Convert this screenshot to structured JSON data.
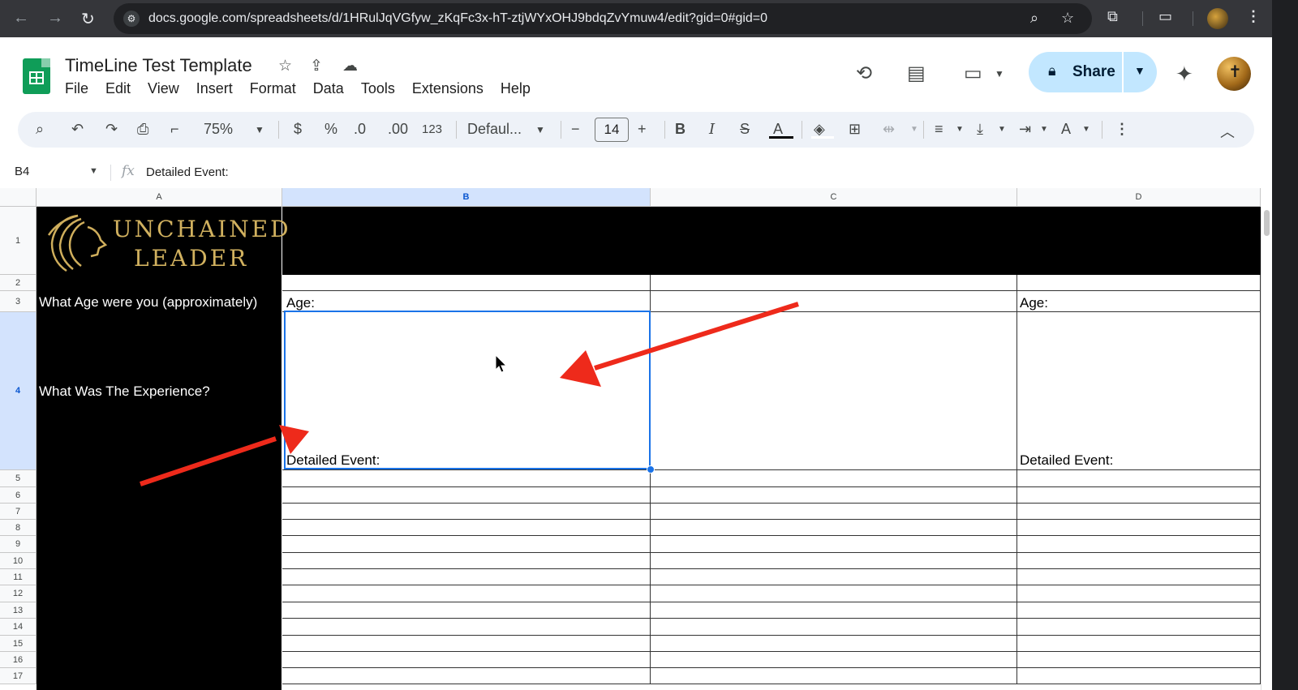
{
  "browser": {
    "url": "docs.google.com/spreadsheets/d/1HRulJqVGfyw_zKqFc3x-hT-ztjWYxOHJ9bdqZvYmuw4/edit?gid=0#gid=0",
    "icons": [
      "back-icon",
      "forward-icon",
      "reload-icon",
      "site-settings-icon",
      "zoom-icon",
      "bookmark-star-icon",
      "extensions-icon",
      "reading-mode-icon",
      "profile-avatar",
      "more-menu-icon"
    ]
  },
  "doc": {
    "title": "TimeLine Test Template",
    "menu": [
      "File",
      "Edit",
      "View",
      "Insert",
      "Format",
      "Data",
      "Tools",
      "Extensions",
      "Help"
    ],
    "share_label": "Share"
  },
  "toolbar": {
    "zoom": "75%",
    "currency": "$",
    "percent": "%",
    "dec_decrease": ".0",
    "dec_increase": ".00",
    "number_format": "123",
    "font": "Defaul...",
    "font_size": "14",
    "colors": {
      "text_color": "#000000",
      "fill_color": "#ffffff",
      "accent": "#1a73e8"
    }
  },
  "formula_bar": {
    "name_box": "B4",
    "fx": "fx",
    "content": "Detailed Event:"
  },
  "grid": {
    "columns": [
      "A",
      "B",
      "C",
      "D"
    ],
    "selected_column": "B",
    "rows": [
      "1",
      "2",
      "3",
      "4",
      "5",
      "6",
      "7",
      "8",
      "9",
      "10",
      "11",
      "12",
      "13",
      "14",
      "15",
      "16",
      "17"
    ],
    "selected_row": "4",
    "logo_line1": "UNCHAINED",
    "logo_line2": "LEADER",
    "row3_question": "What Age were you (approximately)",
    "row4_question": "What Was The Experience?",
    "b3": "Age:",
    "d3": "Age:",
    "b4": "Detailed Event:",
    "d4": "Detailed Event:"
  },
  "annotations": {
    "arrow_color": "#ee2a1b"
  }
}
